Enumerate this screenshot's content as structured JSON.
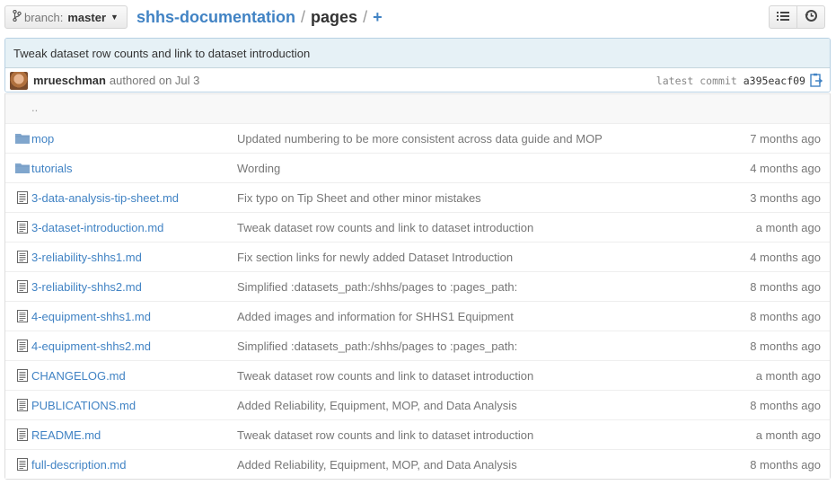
{
  "branch": {
    "label": "branch:",
    "name": "master"
  },
  "breadcrumb": {
    "repo": "shhs-documentation",
    "separator": "/",
    "current": "pages",
    "separator2": "/",
    "plus": "+"
  },
  "commit": {
    "title": "Tweak dataset row counts and link to dataset introduction",
    "author": "mrueschman",
    "authored": "authored on Jul 3",
    "latest_label": "latest commit",
    "sha": "a395eacf09"
  },
  "parent_link": "..",
  "files": [
    {
      "type": "folder",
      "name": "mop",
      "message": "Updated numbering to be more consistent across data guide and MOP",
      "age": "7 months ago"
    },
    {
      "type": "folder",
      "name": "tutorials",
      "message": "Wording",
      "age": "4 months ago"
    },
    {
      "type": "file",
      "name": "3-data-analysis-tip-sheet.md",
      "message": "Fix typo on Tip Sheet and other minor mistakes",
      "age": "3 months ago"
    },
    {
      "type": "file",
      "name": "3-dataset-introduction.md",
      "message": "Tweak dataset row counts and link to dataset introduction",
      "age": "a month ago"
    },
    {
      "type": "file",
      "name": "3-reliability-shhs1.md",
      "message": "Fix section links for newly added Dataset Introduction",
      "age": "4 months ago"
    },
    {
      "type": "file",
      "name": "3-reliability-shhs2.md",
      "message": "Simplified :datasets_path:/shhs/pages to :pages_path:",
      "age": "8 months ago"
    },
    {
      "type": "file",
      "name": "4-equipment-shhs1.md",
      "message": "Added images and information for SHHS1 Equipment",
      "age": "8 months ago"
    },
    {
      "type": "file",
      "name": "4-equipment-shhs2.md",
      "message": "Simplified :datasets_path:/shhs/pages to :pages_path:",
      "age": "8 months ago"
    },
    {
      "type": "file",
      "name": "CHANGELOG.md",
      "message": "Tweak dataset row counts and link to dataset introduction",
      "age": "a month ago"
    },
    {
      "type": "file",
      "name": "PUBLICATIONS.md",
      "message": "Added Reliability, Equipment, MOP, and Data Analysis",
      "age": "8 months ago"
    },
    {
      "type": "file",
      "name": "README.md",
      "message": "Tweak dataset row counts and link to dataset introduction",
      "age": "a month ago"
    },
    {
      "type": "file",
      "name": "full-description.md",
      "message": "Added Reliability, Equipment, MOP, and Data Analysis",
      "age": "8 months ago"
    }
  ],
  "icons": {
    "branch": "branch-icon",
    "list": "list-icon",
    "history": "history-icon",
    "copy": "clipboard-icon",
    "folder": "folder-icon",
    "file": "file-icon"
  },
  "colors": {
    "link": "#4183c4",
    "commit_bg": "#e6f1f6",
    "folder": "#80a6cd"
  }
}
